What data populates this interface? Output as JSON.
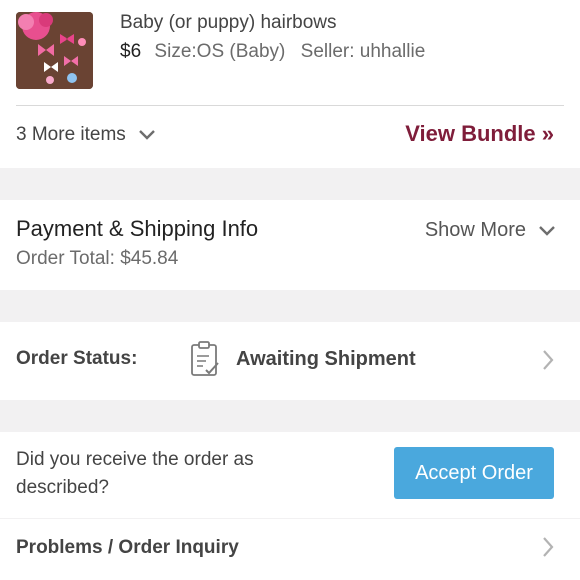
{
  "item": {
    "title": "Baby (or puppy) hairbows",
    "price": "$6",
    "size": "Size:OS (Baby)",
    "seller": "Seller: uhhallie",
    "thumbnail_icon": "hairbows-photo"
  },
  "bundle": {
    "more_items_label": "3 More items",
    "view_bundle_label": "View Bundle »"
  },
  "payment": {
    "title": "Payment & Shipping Info",
    "order_total": "Order Total: $45.84",
    "show_more_label": "Show More"
  },
  "status": {
    "label": "Order Status:",
    "value": "Awaiting Shipment",
    "icon": "clipboard-check-icon"
  },
  "receive": {
    "question": "Did you receive the order as described?",
    "accept_label": "Accept Order"
  },
  "problems": {
    "label": "Problems / Order Inquiry"
  },
  "colors": {
    "accent": "#7f1d3a",
    "button": "#4aa8dd",
    "background": "#f2f1f2"
  }
}
